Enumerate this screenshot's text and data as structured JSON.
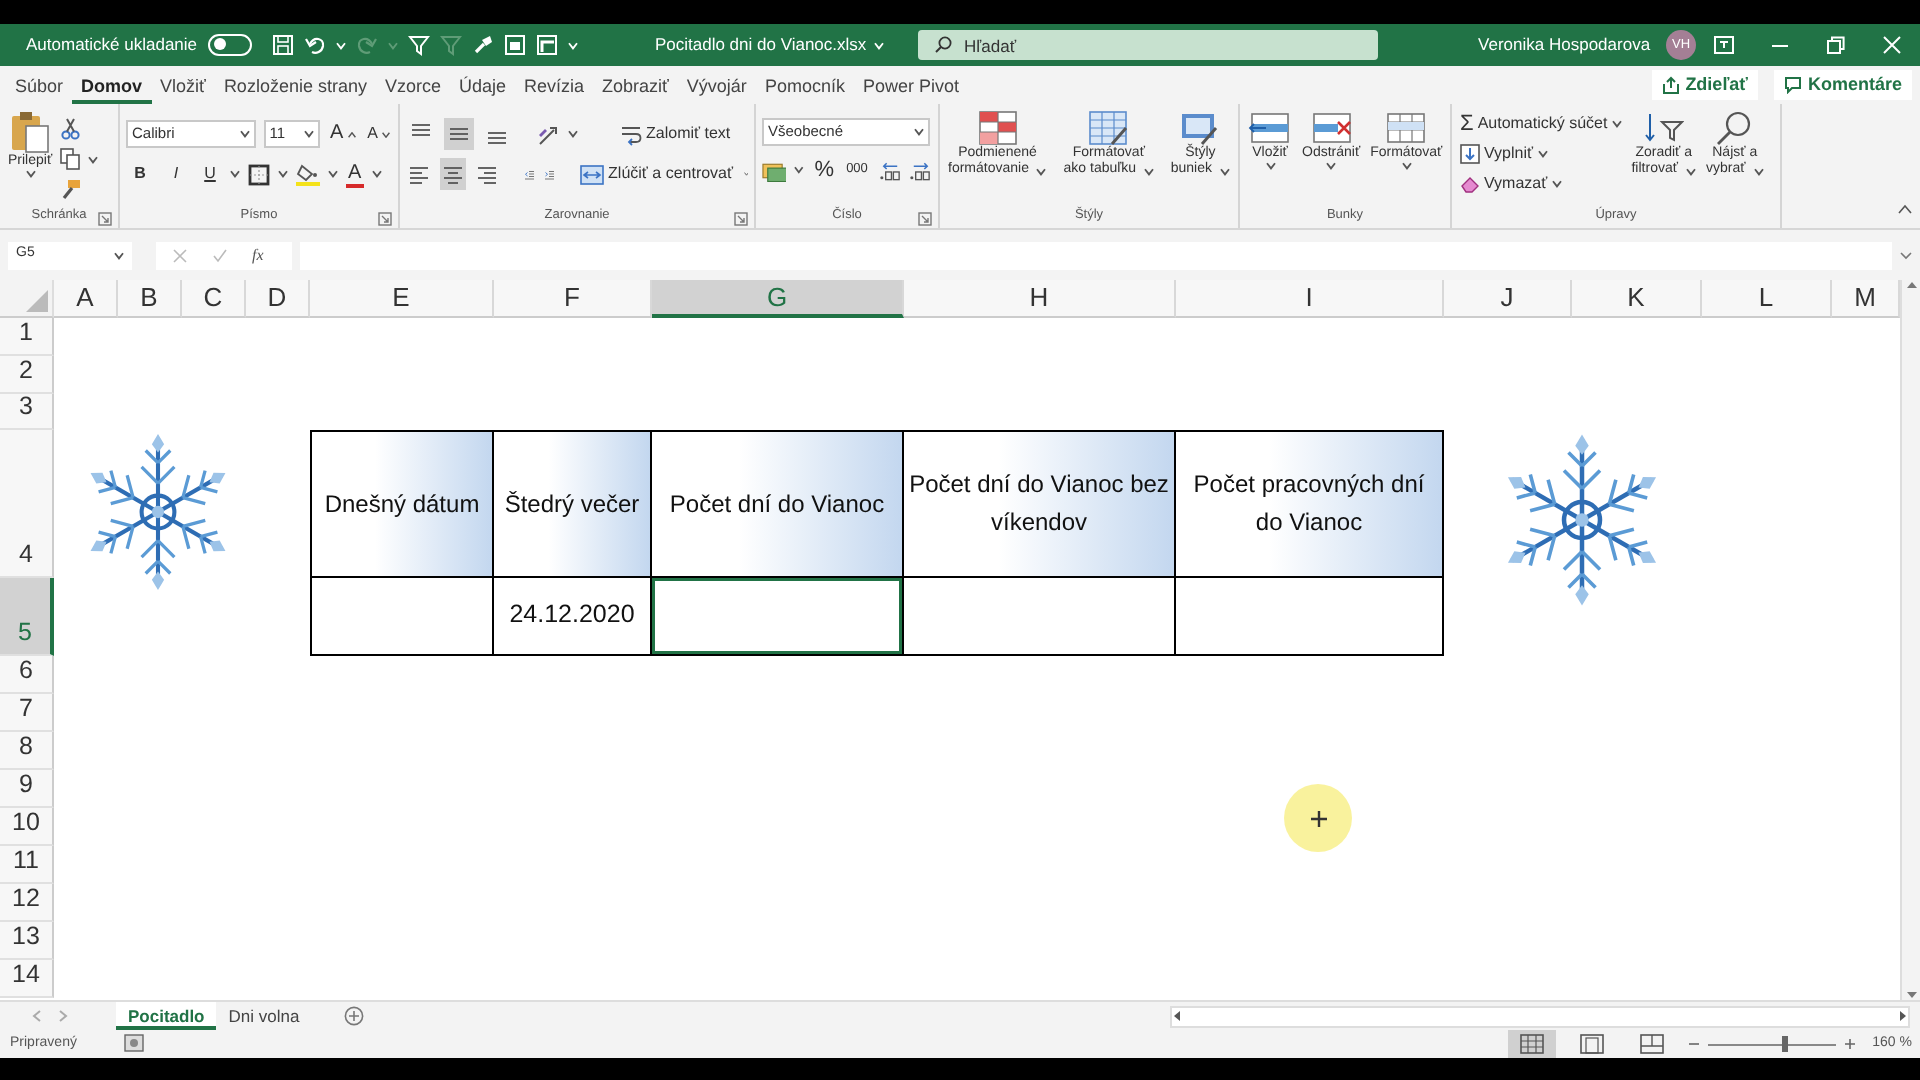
{
  "title_bar": {
    "autosave_label": "Automatické ukladanie",
    "autosave_on": false,
    "file_name": "Pocitadlo dni do Vianoc.xlsx",
    "search_placeholder": "Hľadať",
    "user_name": "Veronika Hospodarova",
    "user_initials": "VH"
  },
  "menu_tabs": [
    {
      "label": "Súbor",
      "selected": false
    },
    {
      "label": "Domov",
      "selected": true
    },
    {
      "label": "Vložiť",
      "selected": false
    },
    {
      "label": "Rozloženie strany",
      "selected": false
    },
    {
      "label": "Vzorce",
      "selected": false
    },
    {
      "label": "Údaje",
      "selected": false
    },
    {
      "label": "Revízia",
      "selected": false
    },
    {
      "label": "Zobraziť",
      "selected": false
    },
    {
      "label": "Vývojár",
      "selected": false
    },
    {
      "label": "Pomocník",
      "selected": false
    },
    {
      "label": "Power Pivot",
      "selected": false
    }
  ],
  "share_button": "Zdieľať",
  "comments_button": "Komentáre",
  "ribbon": {
    "clipboard": {
      "paste": "Prilepiť",
      "label": "Schránka"
    },
    "font": {
      "name": "Calibri",
      "size": "11",
      "grow": "A",
      "shrink": "A",
      "bold": "B",
      "italic": "I",
      "underline": "U",
      "font_color_label": "A",
      "label": "Písmo"
    },
    "alignment": {
      "vertical": [
        {
          "selected": false
        },
        {
          "selected": true
        },
        {
          "selected": false
        }
      ],
      "horizontal": [
        {
          "selected": false
        },
        {
          "selected": true
        },
        {
          "selected": false
        }
      ],
      "wrap": "Zalomiť text",
      "merge": "Zlúčiť a centrovať",
      "label": "Zarovnanie"
    },
    "number": {
      "format": "Všeobecné",
      "percent": "%",
      "thousands": "000",
      "label": "Číslo"
    },
    "styles": {
      "buttons": [
        [
          "Podmienené",
          "formátovanie"
        ],
        [
          "Formátovať",
          "ako tabuľku"
        ],
        [
          "Štýly",
          "buniek"
        ]
      ],
      "label": "Štýly"
    },
    "cells": {
      "buttons": [
        "Vložiť",
        "Odstrániť",
        "Formátovať"
      ],
      "label": "Bunky"
    },
    "editing": {
      "autosum_symbol": "Σ",
      "autosum": "Automatický súčet",
      "fill": "Vyplniť",
      "clear": "Vymazať",
      "sort": [
        "Zoradiť a",
        "filtrovať"
      ],
      "find": [
        "Nájsť a",
        "vybrať"
      ],
      "label": "Úpravy"
    }
  },
  "formula_bar": {
    "name_box": "G5",
    "function_label": "fx"
  },
  "columns": [
    {
      "label": "A",
      "selected": false
    },
    {
      "label": "B",
      "selected": false
    },
    {
      "label": "C",
      "selected": false
    },
    {
      "label": "D",
      "selected": false
    },
    {
      "label": "E",
      "selected": false
    },
    {
      "label": "F",
      "selected": false
    },
    {
      "label": "G",
      "selected": true
    },
    {
      "label": "H",
      "selected": false
    },
    {
      "label": "I",
      "selected": false
    },
    {
      "label": "J",
      "selected": false
    },
    {
      "label": "K",
      "selected": false
    },
    {
      "label": "L",
      "selected": false
    },
    {
      "label": "M",
      "selected": false
    }
  ],
  "rows": [
    {
      "label": "1",
      "selected": false
    },
    {
      "label": "2",
      "selected": false
    },
    {
      "label": "3",
      "selected": false
    },
    {
      "label": "4",
      "selected": false
    },
    {
      "label": "5",
      "selected": true
    },
    {
      "label": "6",
      "selected": false
    },
    {
      "label": "7",
      "selected": false
    },
    {
      "label": "8",
      "selected": false
    },
    {
      "label": "9",
      "selected": false
    },
    {
      "label": "10",
      "selected": false
    },
    {
      "label": "11",
      "selected": false
    },
    {
      "label": "12",
      "selected": false
    },
    {
      "label": "13",
      "selected": false
    },
    {
      "label": "14",
      "selected": false
    }
  ],
  "table": {
    "headers": [
      "Dnešný dátum",
      "Štedrý večer",
      "Počet dní do Vianoc",
      "Počet dní do Vianoc bez víkendov",
      "Počet pracovných dní do Vianoc"
    ],
    "cells": [
      {
        "selected": false
      },
      {
        "value": "24.12.2020",
        "selected": false
      },
      {
        "selected": true
      },
      {
        "selected": false
      },
      {
        "selected": false
      }
    ]
  },
  "sheet_tabs": [
    {
      "label": "Pocitadlo",
      "selected": true
    },
    {
      "label": "Dni volna",
      "selected": false
    }
  ],
  "status_bar": {
    "text": "Pripravený",
    "views": [
      {
        "selected": true
      },
      {
        "selected": false
      },
      {
        "selected": false
      }
    ],
    "zoom": {
      "level": 0.6,
      "reading": "160 %"
    }
  }
}
